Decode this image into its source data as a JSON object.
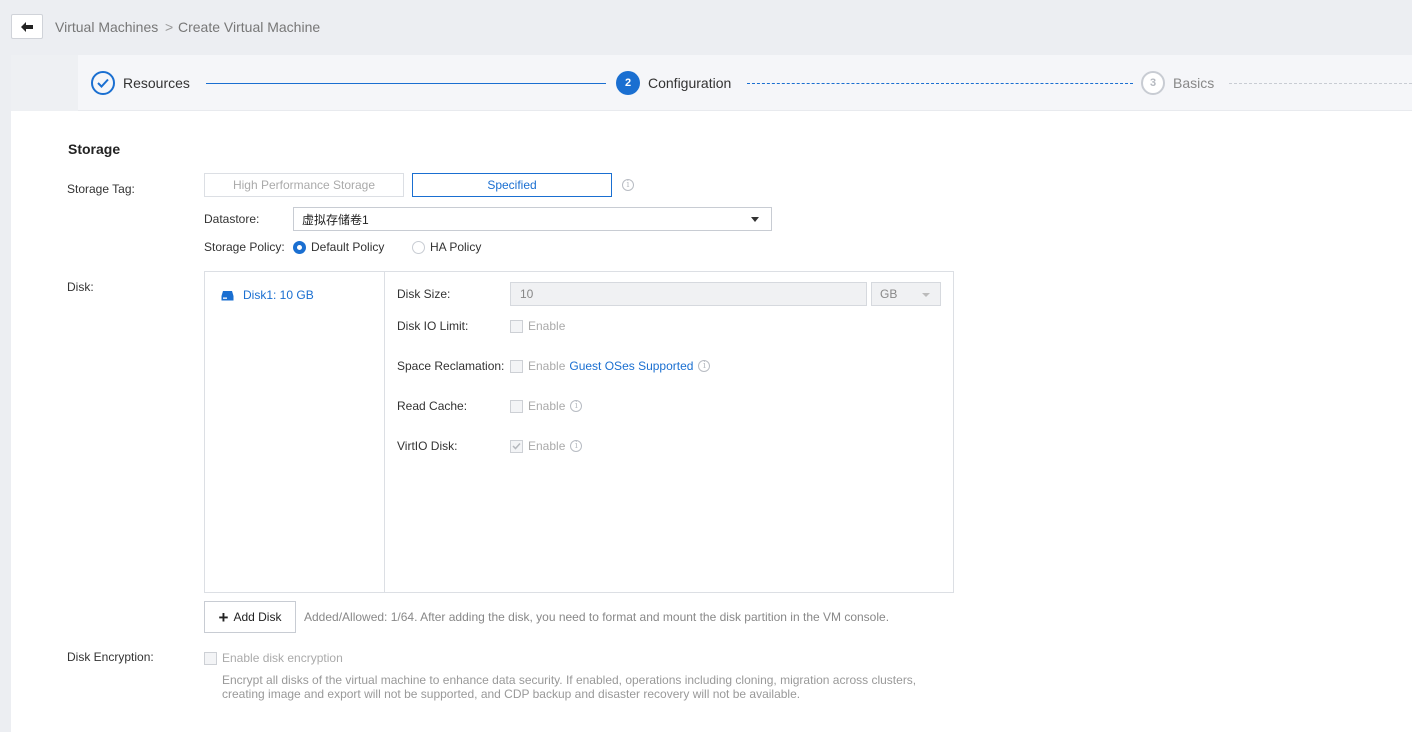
{
  "breadcrumb": {
    "parent": "Virtual Machines",
    "separator": ">",
    "current": "Create Virtual Machine"
  },
  "steps": [
    {
      "label": "Resources",
      "status": "done"
    },
    {
      "label": "Configuration",
      "number": "2",
      "status": "active"
    },
    {
      "label": "Basics",
      "number": "3",
      "status": "pending"
    }
  ],
  "storage": {
    "section_title": "Storage",
    "storage_tag_label": "Storage Tag:",
    "tag_options": [
      "High Performance Storage",
      "Specified"
    ],
    "tag_selected": "Specified",
    "datastore_label": "Datastore:",
    "datastore_value": "虚拟存储卷1",
    "policy_label": "Storage Policy:",
    "policy_options": [
      "Default Policy",
      "HA Policy"
    ],
    "policy_selected": "Default Policy"
  },
  "disk": {
    "label": "Disk:",
    "items": [
      {
        "label": "Disk1:  10 GB"
      }
    ],
    "size_label": "Disk Size:",
    "size_value": "10",
    "size_unit": "GB",
    "io_limit_label": "Disk IO Limit:",
    "space_reclamation_label": "Space Reclamation:",
    "read_cache_label": "Read Cache:",
    "virtio_label": "VirtIO Disk:",
    "enable_text": "Enable",
    "guest_os_link": "Guest OSes Supported",
    "virtio_checked": true,
    "add_button": "Add Disk",
    "add_hint": "Added/Allowed: 1/64. After adding the disk, you need to format and mount the disk partition in the VM console."
  },
  "encryption": {
    "label": "Disk Encryption:",
    "checkbox_label": "Enable disk encryption",
    "description": "Encrypt all disks of the virtual machine to enhance data security. If enabled, operations including cloning, migration across clusters, creating image and export will not be supported, and CDP backup and disaster recovery will not be available."
  },
  "colors": {
    "accent": "#1a6fd1",
    "background": "#eceef2",
    "panel": "#ffffff"
  },
  "icons": {
    "back": "arrow-left-icon",
    "step_done": "check-circle-icon",
    "info": "info-icon",
    "disk": "hard-drive-icon",
    "caret": "chevron-down-icon",
    "add": "plus-icon"
  }
}
